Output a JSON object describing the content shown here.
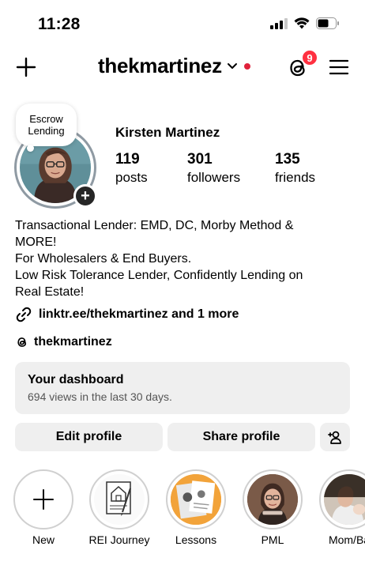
{
  "status": {
    "time": "11:28"
  },
  "header": {
    "username": "thekmartinez",
    "notification_count": "9"
  },
  "profile": {
    "note_line1": "Escrow",
    "note_line2": "Lending",
    "full_name": "Kirsten Martinez",
    "stats": [
      {
        "value": "119",
        "label": "posts"
      },
      {
        "value": "301",
        "label": "followers"
      },
      {
        "value": "135",
        "label": "friends"
      }
    ],
    "bio_lines": [
      "Transactional Lender: EMD, DC, Morby Method &",
      "MORE!",
      "For Wholesalers & End Buyers.",
      "Low Risk Tolerance Lender, Confidently Lending on",
      "Real Estate!"
    ],
    "link": "linktr.ee/thekmartinez and 1 more",
    "threads_handle": "thekmartinez"
  },
  "dashboard": {
    "title": "Your dashboard",
    "subtitle": "694 views in the last 30 days."
  },
  "actions": {
    "edit_label": "Edit profile",
    "share_label": "Share profile"
  },
  "highlights": [
    {
      "label": "New",
      "icon": "plus-icon"
    },
    {
      "label": "REI Journey",
      "icon": "house-contract-icon"
    },
    {
      "label": "Lessons",
      "icon": "lessons-image"
    },
    {
      "label": "PML",
      "icon": "portrait-image"
    },
    {
      "label": "Mom/Ba",
      "icon": "portrait-image"
    }
  ],
  "colors": {
    "badge": "#ff3040",
    "button_bg": "#efefef",
    "text": "#000000"
  }
}
